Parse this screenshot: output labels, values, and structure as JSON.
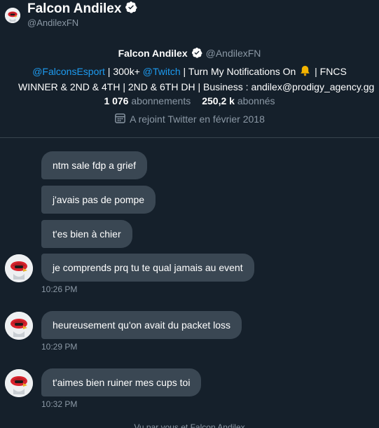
{
  "header": {
    "name": "Falcon Andilex",
    "handle": "@AndilexFN"
  },
  "profile": {
    "name": "Falcon Andilex",
    "handle": "@AndilexFN",
    "bio": {
      "link1": "@FalconsEsport",
      "text1": " | 300k+ ",
      "link2": "@Twitch",
      "text2": " | Turn My Notifications On ",
      "text3": " | FNCS",
      "line2": "WINNER & 2ND & 4TH | 2ND & 6TH DH | Business : andilex@prodigy_agency.gg"
    },
    "following_count": "1 076",
    "following_label": "abonnements",
    "followers_count": "250,2 k",
    "followers_label": "abonnés",
    "joined": "A rejoint Twitter en février 2018"
  },
  "messages": [
    {
      "text": "ntm sale fdp a grief"
    },
    {
      "text": "j'avais pas de pompe"
    },
    {
      "text": "t'es bien à chier"
    },
    {
      "text": "je comprends prq tu te qual jamais au event",
      "time": "10:26 PM"
    },
    {
      "text": "heureusement qu'on avait du packet loss",
      "time": "10:29 PM"
    },
    {
      "text": "t'aimes bien ruiner mes cups toi",
      "time": "10:32 PM"
    }
  ],
  "footer": {
    "seen": "Vu par vous et Falcon Andilex"
  },
  "colors": {
    "background": "#15202b",
    "bubble": "#3a4753",
    "link": "#1d9bf0",
    "muted": "#8b98a5",
    "divider": "#38444d"
  },
  "icons": [
    "falcon-avatar",
    "verified-badge-icon",
    "bell-icon",
    "calendar-icon"
  ]
}
